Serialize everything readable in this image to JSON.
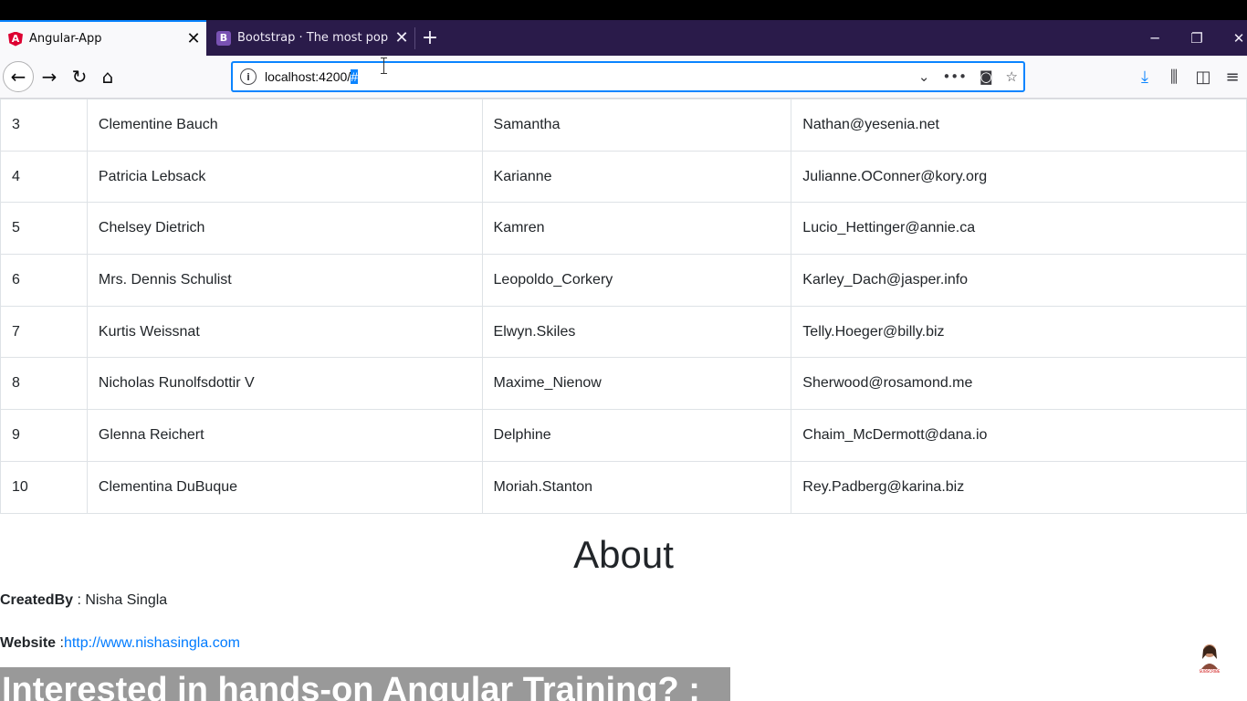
{
  "browser": {
    "tabs": [
      {
        "title": "Angular-App",
        "favicon": "angular-icon",
        "active": true
      },
      {
        "title": "Bootstrap · The most popular HTML",
        "favicon": "bootstrap-icon",
        "active": false
      }
    ],
    "url_base": "localhost:4200/",
    "url_selected": "#"
  },
  "table": {
    "rows": [
      {
        "id": "3",
        "name": "Clementine Bauch",
        "username": "Samantha",
        "email": "Nathan@yesenia.net"
      },
      {
        "id": "4",
        "name": "Patricia Lebsack",
        "username": "Karianne",
        "email": "Julianne.OConner@kory.org"
      },
      {
        "id": "5",
        "name": "Chelsey Dietrich",
        "username": "Kamren",
        "email": "Lucio_Hettinger@annie.ca"
      },
      {
        "id": "6",
        "name": "Mrs. Dennis Schulist",
        "username": "Leopoldo_Corkery",
        "email": "Karley_Dach@jasper.info"
      },
      {
        "id": "7",
        "name": "Kurtis Weissnat",
        "username": "Elwyn.Skiles",
        "email": "Telly.Hoeger@billy.biz"
      },
      {
        "id": "8",
        "name": "Nicholas Runolfsdottir V",
        "username": "Maxime_Nienow",
        "email": "Sherwood@rosamond.me"
      },
      {
        "id": "9",
        "name": "Glenna Reichert",
        "username": "Delphine",
        "email": "Chaim_McDermott@dana.io"
      },
      {
        "id": "10",
        "name": "Clementina DuBuque",
        "username": "Moriah.Stanton",
        "email": "Rey.Padberg@karina.biz"
      }
    ]
  },
  "about": {
    "title": "About",
    "created_label": "CreatedBy",
    "created_sep": " : ",
    "created_value": "Nisha Singla",
    "website_label": "Website",
    "website_sep": " :",
    "website_link": "http://www.nishasingla.com"
  },
  "banner": {
    "text": "Interested in hands-on Angular Training? :"
  },
  "colors": {
    "accent": "#0a84ff",
    "link": "#007bff",
    "tabstrip": "#2a1b4a"
  }
}
